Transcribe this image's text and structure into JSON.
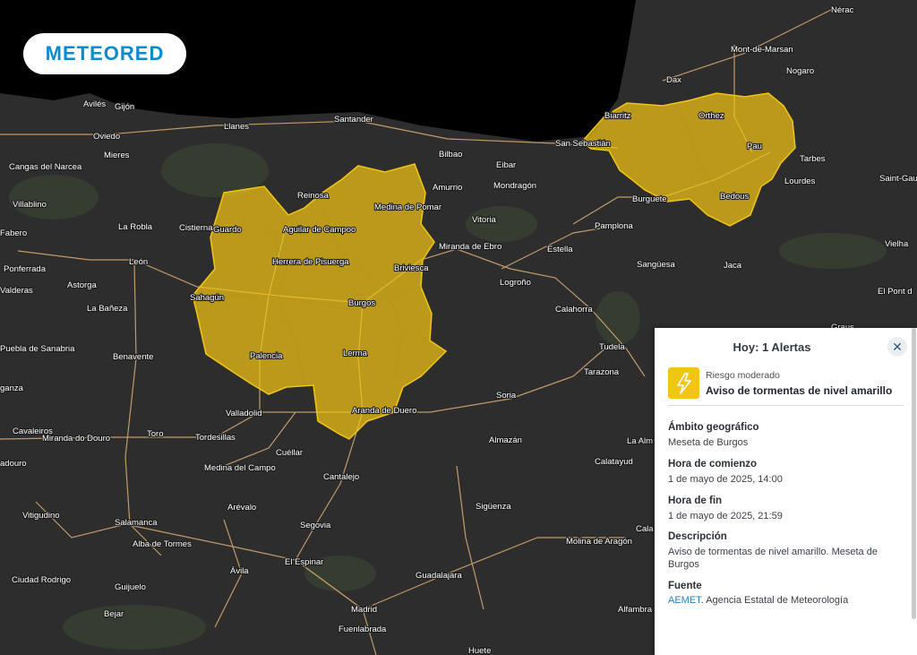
{
  "brand": {
    "logo_text": "METEORED"
  },
  "map": {
    "cities": [
      "Nérac",
      "Mont-de-Marsan",
      "Nogaro",
      "Dax",
      "Biarritz",
      "Orthez",
      "Pau",
      "Tarbes",
      "Lourdes",
      "Saint-Gau",
      "Bedous",
      "San Sebastián",
      "Burguete",
      "Pamplona",
      "Sangüesa",
      "Jaca",
      "Vielha",
      "El Pont d",
      "Avilés",
      "Gijón",
      "Oviedo",
      "Mieres",
      "Llanes",
      "Santander",
      "Bilbao",
      "Eibar",
      "Amurrio",
      "Mondragón",
      "Reinosa",
      "Vitoria",
      "Medina de Pomar",
      "Cangas del Narcea",
      "Villablino",
      "Guardo",
      "Aguilar de Campoo",
      "Cistierna",
      "La Robla",
      "León",
      "Fabero",
      "Ponferrada",
      "Astorga",
      "Herrera de Pisuerga",
      "Briviesca",
      "Miranda de Ebro",
      "Estella",
      "Sahagún",
      "Burgos",
      "Logroño",
      "Calahorra",
      "La Bañeza",
      "Valderas",
      "Puebla de Sanabria",
      "Benavente",
      "Palencia",
      "Lerma",
      "Tudela",
      "Tarazona",
      "Soria",
      "Aranda de Duero",
      "Valladolid",
      "Almazán",
      "ganza",
      "Cavaleiros",
      "Miranda do Douro",
      "Toro",
      "Tordesillas",
      "Cuéllar",
      "Calatayud",
      "La Alm",
      "Medina del Campo",
      "Cantalejo",
      "Sigüenza",
      "Vitigudino",
      "Salamanca",
      "Arévalo",
      "Segovia",
      "Alba de Tormes",
      "Molina de Aragón",
      "Cala",
      "El Espinar",
      "Ávila",
      "Guadalajara",
      "Ciudad Rodrigo",
      "Guijuelo",
      "Madrid",
      "Fuenlabrada",
      "Bejar",
      "Alfambra",
      "Huete",
      "adouro",
      "Graus"
    ]
  },
  "panel": {
    "title": "Hoy: 1 Alertas",
    "close_icon": "close-icon",
    "alert": {
      "risk": "Riesgo moderado",
      "title": "Aviso de tormentas de nivel amarillo",
      "icon": "thunderstorm-icon",
      "color": "#f2c515"
    },
    "fields": {
      "area_label": "Ámbito geográfico",
      "area_value": "Meseta de Burgos",
      "start_label": "Hora de comienzo",
      "start_value": "1 de mayo de 2025, 14:00",
      "end_label": "Hora de fin",
      "end_value": "1 de mayo de 2025, 21:59",
      "desc_label": "Descripción",
      "desc_value": "Aviso de tormentas de nivel amarillo. Meseta de Burgos",
      "source_label": "Fuente",
      "source_link": "AEMET",
      "source_rest": ". Agencia Estatal de Meteorología"
    }
  },
  "colors": {
    "alert_yellow": "#f2c515",
    "land": "#2e2e2e",
    "sea": "#000000",
    "roads": "#e8b47a"
  }
}
